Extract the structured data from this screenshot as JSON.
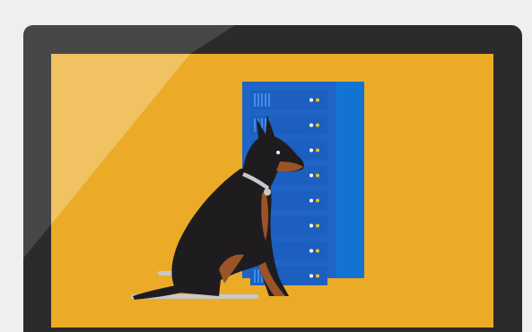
{
  "scene": {
    "subject": "guard-dog-and-server-rack",
    "colors": {
      "page_background": "#efefef",
      "monitor_bezel": "#2b2b2b",
      "screen": "#ebab27",
      "screen_glare": "#f1c56c",
      "server_front": "#1f64c6",
      "server_side": "#1373d3",
      "server_panel": "#1c5fbf",
      "server_led_white": "#ffffff",
      "server_led_yellow": "#f2c21b",
      "dog_body": "#1e1c1e",
      "dog_markings": "#9a5427",
      "dog_collar": "#c9c9c9",
      "floor_lines": "#c8c8c8"
    },
    "server": {
      "slot_count": 8
    }
  }
}
